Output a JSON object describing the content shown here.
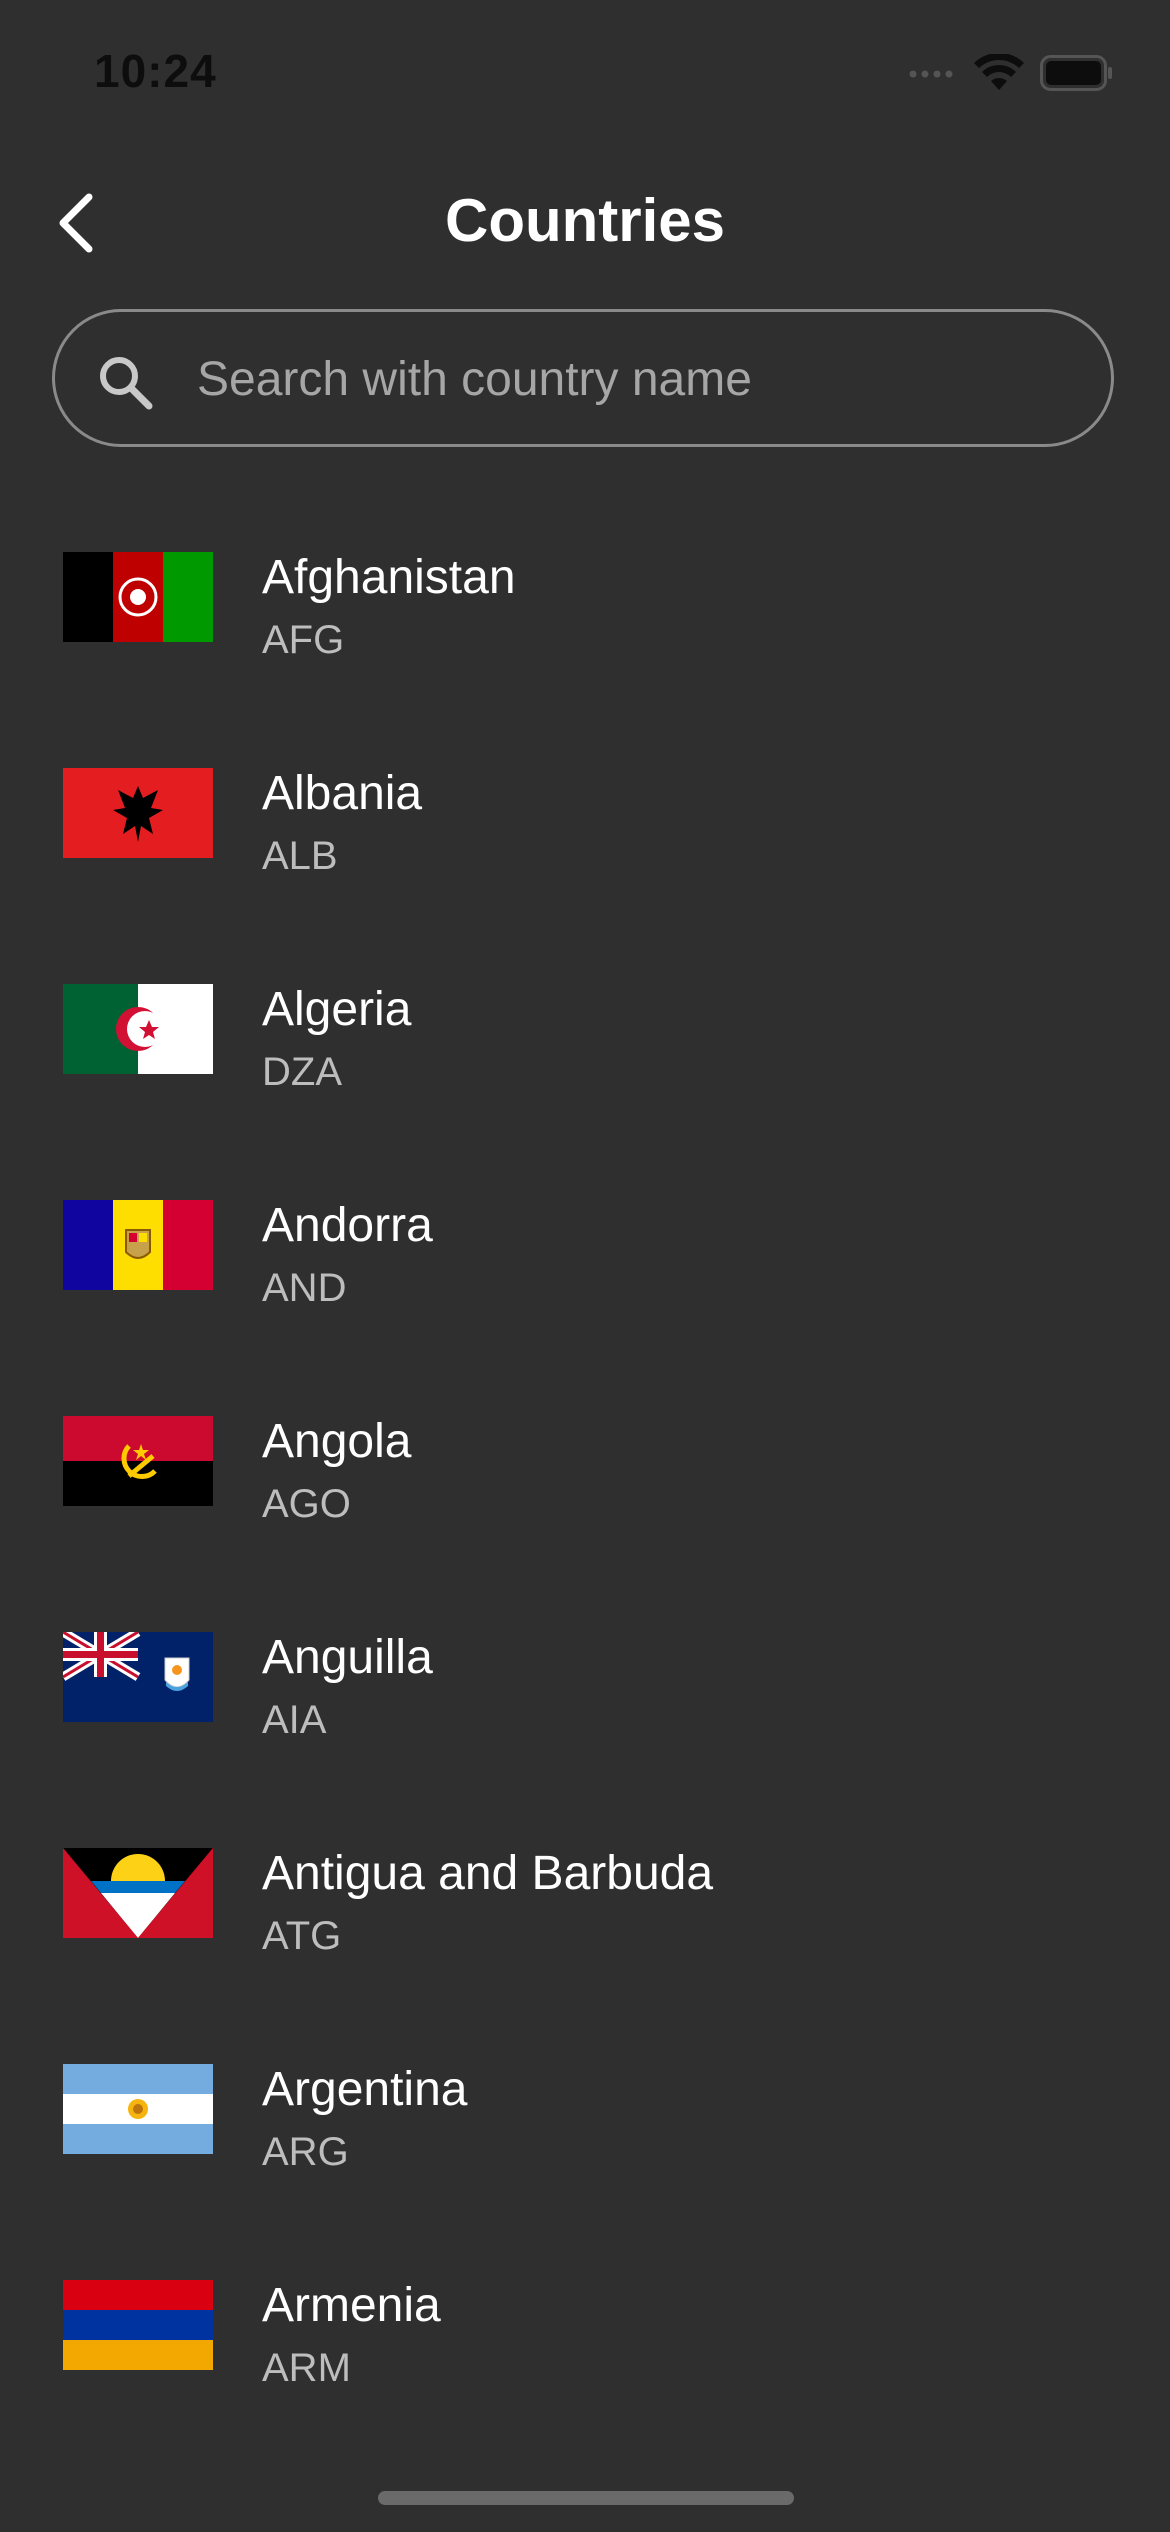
{
  "status_bar": {
    "time": "10:24"
  },
  "header": {
    "title": "Countries",
    "back_icon": "chevron-left-icon"
  },
  "search": {
    "placeholder": "Search with country name",
    "value": "",
    "icon": "search-icon"
  },
  "countries": [
    {
      "name": "Afghanistan",
      "code": "AFG"
    },
    {
      "name": "Albania",
      "code": "ALB"
    },
    {
      "name": "Algeria",
      "code": "DZA"
    },
    {
      "name": "Andorra",
      "code": "AND"
    },
    {
      "name": "Angola",
      "code": "AGO"
    },
    {
      "name": "Anguilla",
      "code": "AIA"
    },
    {
      "name": "Antigua and Barbuda",
      "code": "ATG"
    },
    {
      "name": "Argentina",
      "code": "ARG"
    },
    {
      "name": "Armenia",
      "code": "ARM"
    }
  ],
  "colors": {
    "background": "#2f2f2f",
    "text_primary": "#ffffff",
    "text_secondary": "#bdbdbd",
    "search_border": "#8a8a8a"
  }
}
